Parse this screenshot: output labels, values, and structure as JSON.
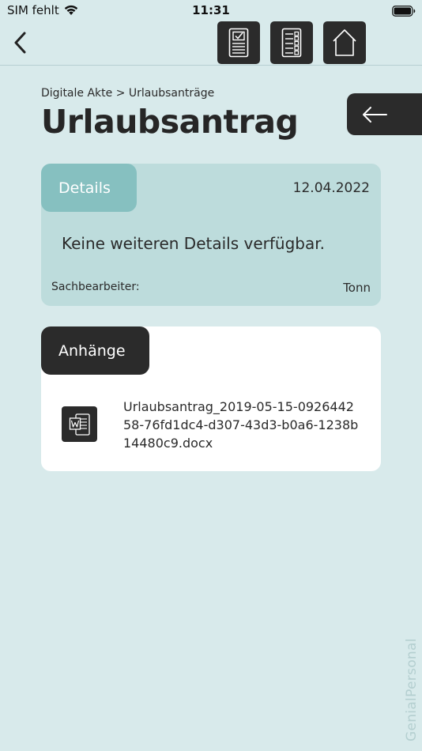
{
  "status_bar": {
    "carrier": "SIM fehlt",
    "time": "11:31"
  },
  "nav": {
    "buttons": [
      {
        "icon": "checklist-document-icon"
      },
      {
        "icon": "task-list-icon"
      },
      {
        "icon": "home-icon"
      }
    ]
  },
  "page": {
    "breadcrumb": "Digitale Akte > Urlaubsanträge",
    "title": "Urlaubsantrag"
  },
  "details": {
    "tab_label": "Details",
    "date": "12.04.2022",
    "text": "Keine weiteren Details verfügbar.",
    "clerk_label": "Sachbearbeiter:",
    "clerk_value": "Tonn"
  },
  "attachments": {
    "tab_label": "Anhänge",
    "items": [
      {
        "icon": "word-document-icon",
        "name": "Urlaubsantrag_2019-05-15-092644258-76fd1dc4-d307-43d3-b0a6-1238b14480c9.docx"
      }
    ]
  },
  "watermark": "GenialPersonal",
  "colors": {
    "background": "#d8eaeb",
    "dark": "#2b2b2b",
    "details_card": "#bddcdc",
    "details_tab": "#86c0c0"
  }
}
